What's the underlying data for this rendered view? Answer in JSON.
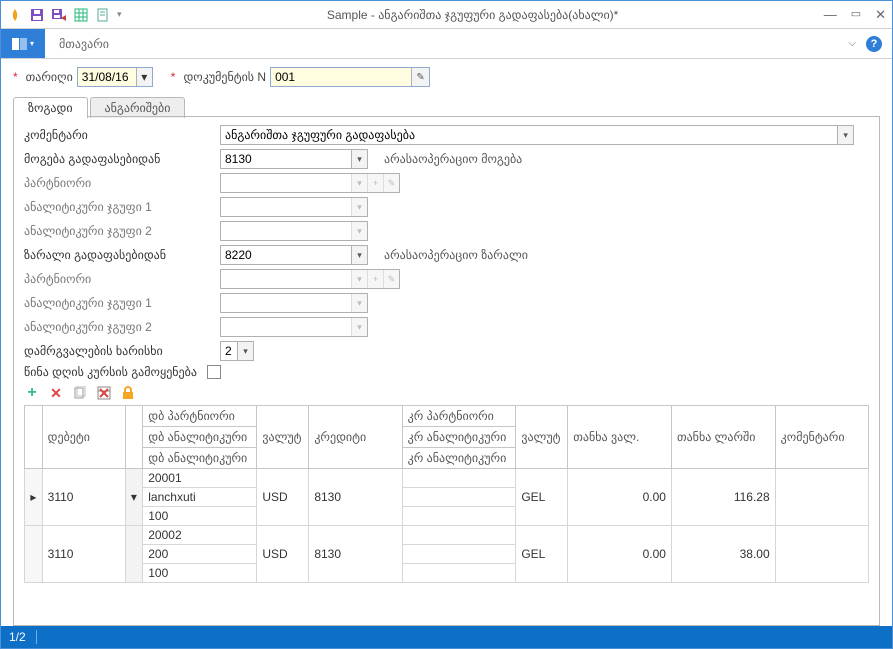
{
  "window": {
    "title": "Sample - ანგარიშთა ჯგუფური გადაფასება(ახალი)*"
  },
  "ribbon": {
    "menu": "მთავარი"
  },
  "header": {
    "date_label": "თარიღი",
    "date_value": "31/08/16",
    "docn_label": "დოკუმენტის N",
    "docn_value": "001"
  },
  "tabs": [
    {
      "key": "general",
      "label": "ზოგადი",
      "active": true
    },
    {
      "key": "accounts",
      "label": "ანგარიშები",
      "active": false
    }
  ],
  "form": {
    "comment_label": "კომენტარი",
    "comment_value": "ანგარიშთა ჯგუფური გადაფასება",
    "profit_label": "მოგება გადაფასებიდან",
    "profit_value": "8130",
    "profit_desc": "არასაოპერაციო მოგება",
    "partner_label_1": "პარტნიორი",
    "an_group1_label_1": "ანალიტიკური ჯგუფი 1",
    "an_group2_label_1": "ანალიტიკური ჯგუფი 2",
    "loss_label": "ზარალი გადაფასებიდან",
    "loss_value": "8220",
    "loss_desc": "არასაოპერაციო ზარალი",
    "partner_label_2": "პარტნიორი",
    "an_group1_label_2": "ანალიტიკური ჯგუფი 1",
    "an_group2_label_2": "ანალიტიკური ჯგუფი 2",
    "round_label": "დამრგვალების ხარისხი",
    "round_value": "2",
    "prev_rate_label": "წინა დღის კურსის გამოყენება"
  },
  "grid_headers": {
    "debit": "დებეტი",
    "db_partner": "დბ პარტნიორი",
    "db_an1": "დბ ანალიტიკური",
    "db_an2": "დბ ანალიტიკური",
    "cur1": "ვალუტ",
    "credit": "კრედიტი",
    "cr_partner": "კრ პარტნიორი",
    "cr_an1": "კრ ანალიტიკური",
    "cr_an2": "კრ ანალიტიკური",
    "cur2": "ვალუტ",
    "amount_fc": "თანხა ვალ.",
    "amount_gel": "თანხა ლარში",
    "comment": "კომენტარი"
  },
  "grid_rows": [
    {
      "selected": "▸",
      "debit": "3110",
      "db_partner": "20001",
      "db_an1": "lanchxuti",
      "db_an2": "100",
      "cur1": "USD",
      "credit": "8130",
      "cr_partner": "",
      "cr_an1": "",
      "cr_an2": "",
      "cur2": "GEL",
      "amount_fc": "0.00",
      "amount_gel": "116.28",
      "comment": ""
    },
    {
      "selected": "",
      "debit": "3110",
      "db_partner": "20002",
      "db_an1": "200",
      "db_an2": "100",
      "cur1": "USD",
      "credit": "8130",
      "cr_partner": "",
      "cr_an1": "",
      "cr_an2": "",
      "cur2": "GEL",
      "amount_fc": "0.00",
      "amount_gel": "38.00",
      "comment": ""
    }
  ],
  "status": {
    "pos": "1/2"
  },
  "chart_data": {
    "type": "table",
    "columns": [
      "debit",
      "db_partner",
      "db_an1",
      "db_an2",
      "cur1",
      "credit",
      "cur2",
      "amount_fc",
      "amount_gel"
    ],
    "rows": [
      [
        "3110",
        "20001",
        "lanchxuti",
        "100",
        "USD",
        "8130",
        "GEL",
        0.0,
        116.28
      ],
      [
        "3110",
        "20002",
        "200",
        "100",
        "USD",
        "8130",
        "GEL",
        0.0,
        38.0
      ]
    ]
  }
}
